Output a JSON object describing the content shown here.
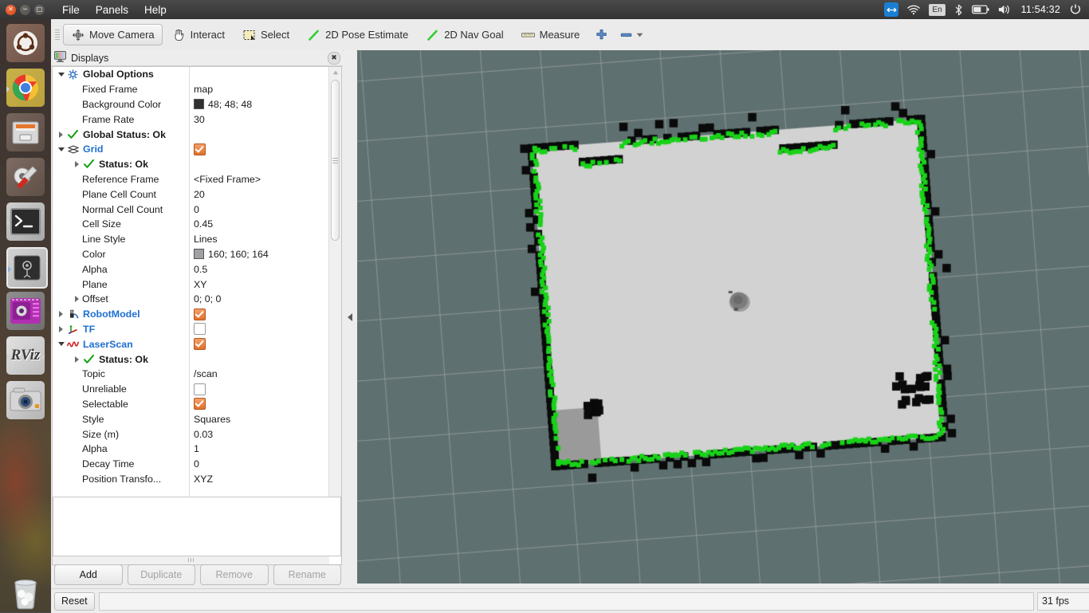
{
  "desktop": {
    "menu": [
      "File",
      "Panels",
      "Help"
    ],
    "window_buttons": [
      "close",
      "minimize",
      "maximize"
    ],
    "indicators": {
      "teamviewer": "teamviewer-icon",
      "wifi": "wifi-icon",
      "keyboard_layout": "En",
      "bluetooth": "bluetooth-icon",
      "battery": "battery-icon",
      "volume": "volume-icon",
      "clock": "11:54:32",
      "power": "power-gear-icon"
    },
    "launcher": [
      {
        "name": "ubuntu-dash",
        "label": "Ubuntu Dash"
      },
      {
        "name": "google-chrome",
        "label": "Google Chrome"
      },
      {
        "name": "files",
        "label": "Files"
      },
      {
        "name": "system-settings",
        "label": "System Settings"
      },
      {
        "name": "terminal",
        "label": "Terminal"
      },
      {
        "name": "gazebo",
        "label": "Gazebo"
      },
      {
        "name": "virtual-machine",
        "label": "Virtual Machine Manager"
      },
      {
        "name": "rviz",
        "label": "RViz"
      },
      {
        "name": "camera-app",
        "label": "Camera"
      },
      {
        "name": "trash",
        "label": "Trash"
      }
    ]
  },
  "toolbar": {
    "buttons": [
      {
        "label": "Move Camera",
        "icon": "move-camera-icon",
        "active": true
      },
      {
        "label": "Interact",
        "icon": "hand-icon",
        "active": false
      },
      {
        "label": "Select",
        "icon": "select-rect-icon",
        "active": false
      },
      {
        "label": "2D Pose Estimate",
        "icon": "pose-arrow-icon",
        "active": false
      },
      {
        "label": "2D Nav Goal",
        "icon": "nav-arrow-icon",
        "active": false
      },
      {
        "label": "Measure",
        "icon": "ruler-icon",
        "active": false
      }
    ],
    "add_tool_icon": "plus-icon",
    "remove_tool_icon": "minus-icon",
    "remove_tool_dropdown_icon": "chevron-down-icon"
  },
  "displays_panel": {
    "title": "Displays",
    "close_icon": "close-icon",
    "rows": [
      {
        "twisty": "open",
        "indent": 0,
        "icon": "gear-icon",
        "label": "Global Options",
        "type": "group",
        "value": ""
      },
      {
        "twisty": "none",
        "indent": 1,
        "icon": "",
        "label": "Fixed Frame",
        "type": "prop",
        "value": "map"
      },
      {
        "twisty": "none",
        "indent": 1,
        "icon": "",
        "label": "Background Color",
        "type": "color",
        "value": "48; 48; 48",
        "swatch": "#303030"
      },
      {
        "twisty": "none",
        "indent": 1,
        "icon": "",
        "label": "Frame Rate",
        "type": "prop",
        "value": "30"
      },
      {
        "twisty": "closed",
        "indent": 0,
        "icon": "check-icon",
        "label": "Global Status: Ok",
        "type": "status",
        "value": ""
      },
      {
        "twisty": "open",
        "indent": 0,
        "icon": "grid-icon",
        "label": "Grid",
        "type": "display",
        "value": "checked"
      },
      {
        "twisty": "closed",
        "indent": 1,
        "icon": "check-icon",
        "label": "Status: Ok",
        "type": "status",
        "value": ""
      },
      {
        "twisty": "none",
        "indent": 1,
        "icon": "",
        "label": "Reference Frame",
        "type": "prop",
        "value": "<Fixed Frame>"
      },
      {
        "twisty": "none",
        "indent": 1,
        "icon": "",
        "label": "Plane Cell Count",
        "type": "prop",
        "value": "20"
      },
      {
        "twisty": "none",
        "indent": 1,
        "icon": "",
        "label": "Normal Cell Count",
        "type": "prop",
        "value": "0"
      },
      {
        "twisty": "none",
        "indent": 1,
        "icon": "",
        "label": "Cell Size",
        "type": "prop",
        "value": "0.45"
      },
      {
        "twisty": "none",
        "indent": 1,
        "icon": "",
        "label": "Line Style",
        "type": "prop",
        "value": "Lines"
      },
      {
        "twisty": "none",
        "indent": 1,
        "icon": "",
        "label": "Color",
        "type": "color",
        "value": "160; 160; 164",
        "swatch": "#a0a0a4"
      },
      {
        "twisty": "none",
        "indent": 1,
        "icon": "",
        "label": "Alpha",
        "type": "prop",
        "value": "0.5"
      },
      {
        "twisty": "none",
        "indent": 1,
        "icon": "",
        "label": "Plane",
        "type": "prop",
        "value": "XY"
      },
      {
        "twisty": "closed",
        "indent": 1,
        "icon": "",
        "label": "Offset",
        "type": "prop",
        "value": "0; 0; 0"
      },
      {
        "twisty": "closed",
        "indent": 0,
        "icon": "robot-icon",
        "label": "RobotModel",
        "type": "display",
        "value": "checked"
      },
      {
        "twisty": "closed",
        "indent": 0,
        "icon": "tf-axes-icon",
        "label": "TF",
        "type": "display-off",
        "value": "unchecked"
      },
      {
        "twisty": "open",
        "indent": 0,
        "icon": "laserscan-icon",
        "label": "LaserScan",
        "type": "display",
        "value": "checked"
      },
      {
        "twisty": "closed",
        "indent": 1,
        "icon": "check-icon",
        "label": "Status: Ok",
        "type": "status",
        "value": ""
      },
      {
        "twisty": "none",
        "indent": 1,
        "icon": "",
        "label": "Topic",
        "type": "prop",
        "value": "/scan"
      },
      {
        "twisty": "none",
        "indent": 1,
        "icon": "",
        "label": "Unreliable",
        "type": "checkbox-off",
        "value": "unchecked"
      },
      {
        "twisty": "none",
        "indent": 1,
        "icon": "",
        "label": "Selectable",
        "type": "checkbox-on",
        "value": "checked"
      },
      {
        "twisty": "none",
        "indent": 1,
        "icon": "",
        "label": "Style",
        "type": "prop",
        "value": "Squares"
      },
      {
        "twisty": "none",
        "indent": 1,
        "icon": "",
        "label": "Size (m)",
        "type": "prop",
        "value": "0.03"
      },
      {
        "twisty": "none",
        "indent": 1,
        "icon": "",
        "label": "Alpha",
        "type": "prop",
        "value": "1"
      },
      {
        "twisty": "none",
        "indent": 1,
        "icon": "",
        "label": "Decay Time",
        "type": "prop",
        "value": "0"
      },
      {
        "twisty": "none",
        "indent": 1,
        "icon": "",
        "label": "Position Transfo...",
        "type": "prop",
        "value": "XYZ"
      }
    ],
    "buttons": [
      {
        "label": "Add",
        "enabled": true
      },
      {
        "label": "Duplicate",
        "enabled": false
      },
      {
        "label": "Remove",
        "enabled": false
      },
      {
        "label": "Rename",
        "enabled": false
      }
    ]
  },
  "view3d": {
    "background_color": "#5f7070",
    "grid_color": "#a0a0a4",
    "map_free_color": "#d2d2d2",
    "map_occupied_color": "#0a0a0a",
    "laserscan_color": "#19d219",
    "robot_color": "#7c7c7c"
  },
  "statusbar": {
    "reset_label": "Reset",
    "message": "",
    "fps": "31 fps"
  }
}
